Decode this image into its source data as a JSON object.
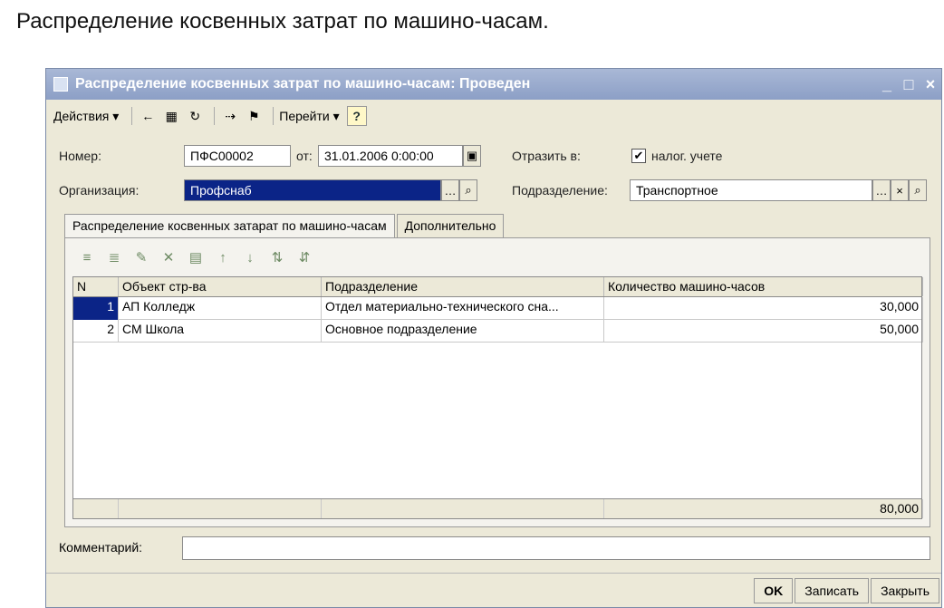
{
  "slide_title": "Распределение косвенных затрат по машино-часам.",
  "window": {
    "title": "Распределение косвенных затрат по машино-часам: Проведен",
    "controls": {
      "minimize": "_",
      "maximize": "□",
      "close": "×"
    }
  },
  "toolbar": {
    "actions_label": "Действия",
    "goto_label": "Перейти",
    "help_label": "?",
    "icons": [
      "arrow-left-icon",
      "chart-icon",
      "refresh-icon",
      "document-icon",
      "cancel-post-icon"
    ]
  },
  "form": {
    "number_label": "Номер:",
    "number_value": "ПФС00002",
    "from_label": "от:",
    "date_value": "31.01.2006  0:00:00",
    "reflect_label": "Отразить в:",
    "tax_checkbox_label": "налог. учете",
    "tax_checked": true,
    "org_label": "Организация:",
    "org_value": "Профснаб",
    "division_label": "Подразделение:",
    "division_value": "Транспортное"
  },
  "tabs": [
    {
      "label": "Распределение косвенных затарат по машино-часам",
      "active": true
    },
    {
      "label": "Дополнительно",
      "active": false
    }
  ],
  "grid": {
    "headers": [
      "N",
      "Объект стр-ва",
      "Подразделение",
      "Количество машино-часов"
    ],
    "rows": [
      {
        "n": "1",
        "object": "АП Колледж",
        "division": "Отдел материально-технического сна...",
        "hours": "30,000"
      },
      {
        "n": "2",
        "object": "СМ Школа",
        "division": "Основное подразделение",
        "hours": "50,000"
      }
    ],
    "total_hours": "80,000"
  },
  "comment": {
    "label": "Комментарий:",
    "value": ""
  },
  "buttons": {
    "ok": "OK",
    "save": "Записать",
    "close": "Закрыть"
  }
}
